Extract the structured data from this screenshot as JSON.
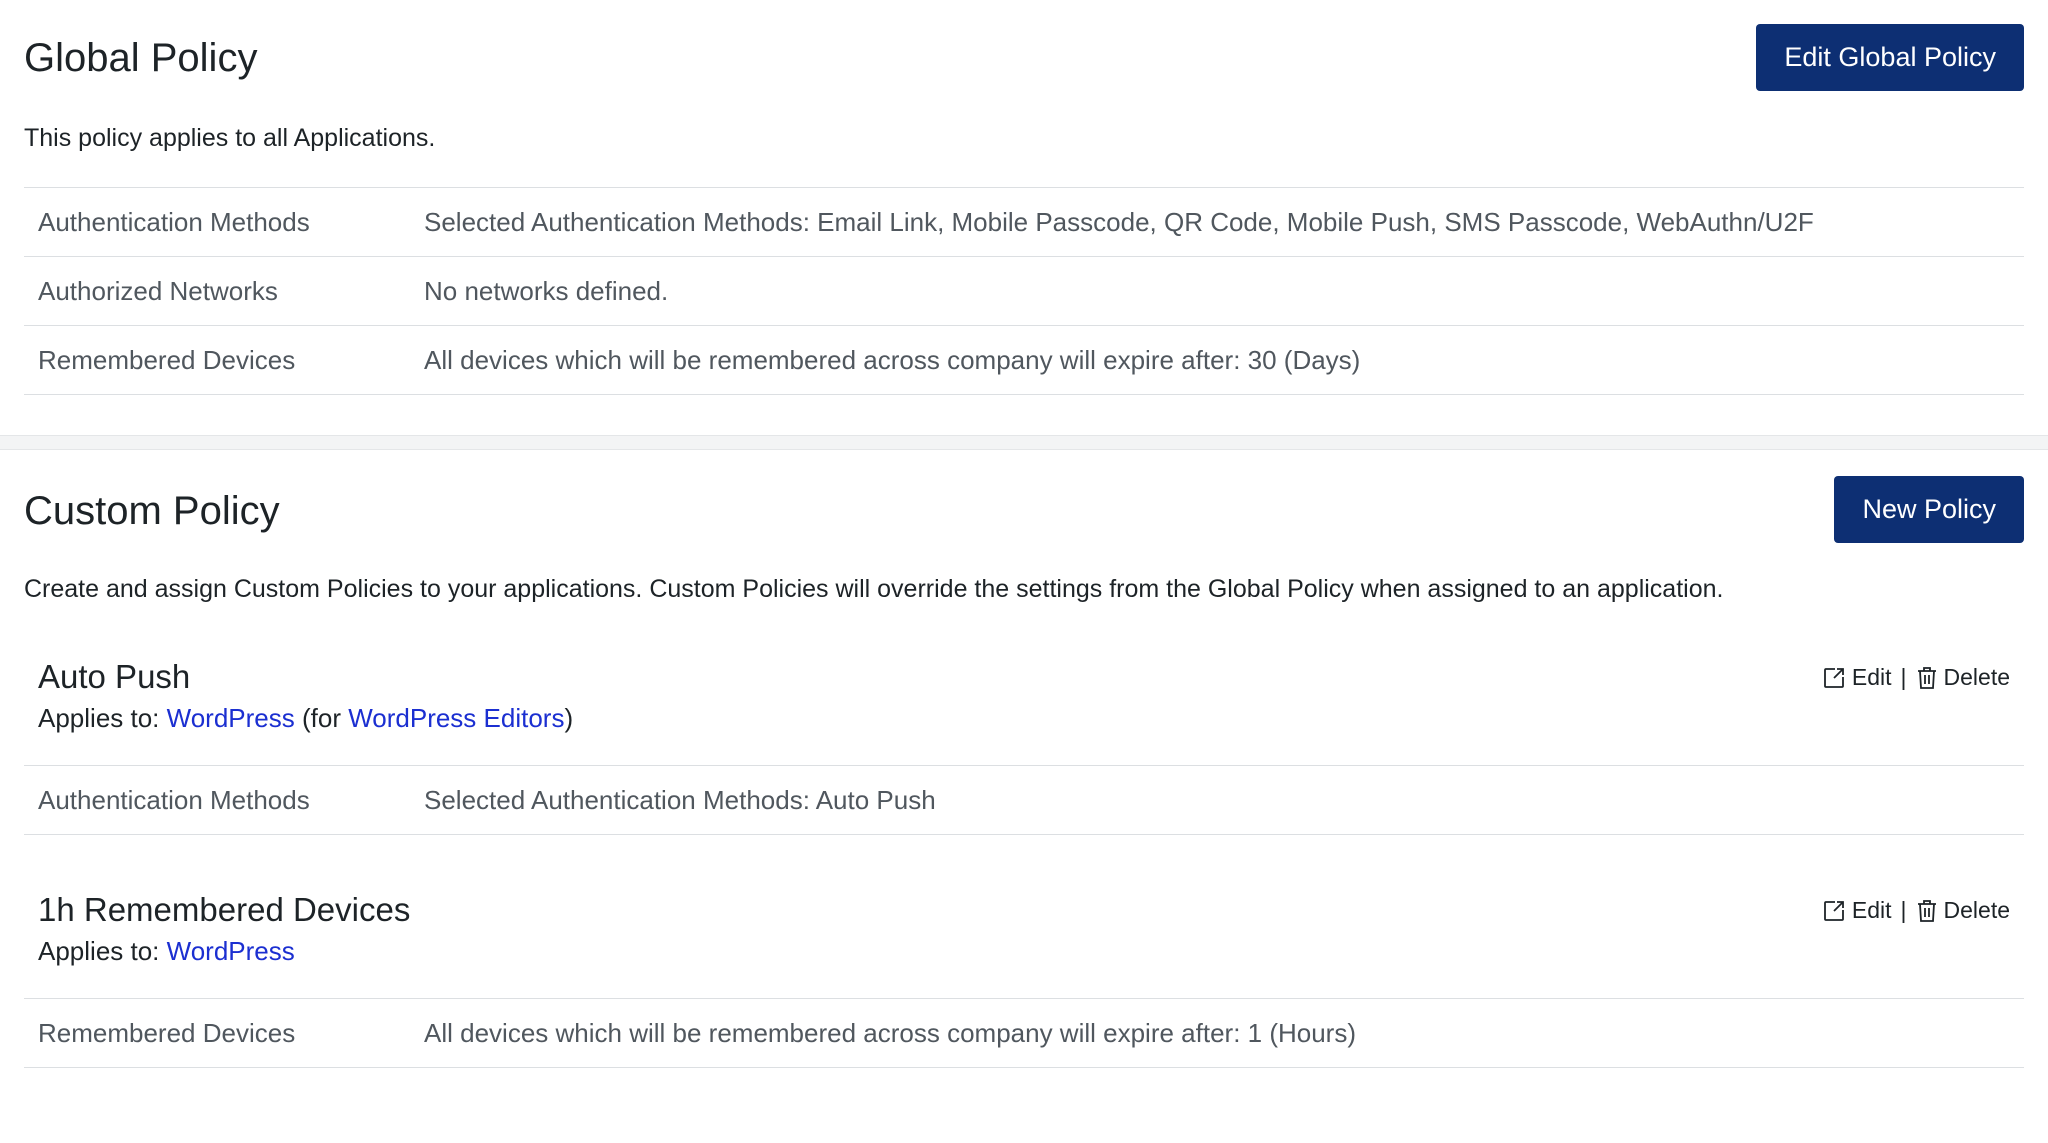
{
  "global": {
    "title": "Global Policy",
    "edit_button": "Edit Global Policy",
    "description": "This policy applies to all Applications.",
    "rows": [
      {
        "label": "Authentication Methods",
        "value": "Selected Authentication Methods: Email Link, Mobile Passcode, QR Code, Mobile Push, SMS Passcode, WebAuthn/U2F"
      },
      {
        "label": "Authorized Networks",
        "value": "No networks defined."
      },
      {
        "label": "Remembered Devices",
        "value": "All devices which will be remembered across company will expire after: 30 (Days)"
      }
    ]
  },
  "custom": {
    "title": "Custom Policy",
    "new_button": "New Policy",
    "description": "Create and assign Custom Policies to your applications. Custom Policies will override the settings from the Global Policy when assigned to an application.",
    "policies": [
      {
        "name": "Auto Push",
        "applies_prefix": "Applies to: ",
        "app_link": "WordPress",
        "for_open": " (for ",
        "role_link": "WordPress Editors",
        "for_close": ")",
        "edit_label": "Edit",
        "separator": "|",
        "delete_label": "Delete",
        "rows": [
          {
            "label": "Authentication Methods",
            "value": "Selected Authentication Methods: Auto Push"
          }
        ]
      },
      {
        "name": "1h Remembered Devices",
        "applies_prefix": "Applies to: ",
        "app_link": "WordPress",
        "edit_label": "Edit",
        "separator": "|",
        "delete_label": "Delete",
        "rows": [
          {
            "label": "Remembered Devices",
            "value": "All devices which will be remembered across company will expire after: 1 (Hours)"
          }
        ]
      }
    ]
  },
  "colors": {
    "primary_button": "#0d2f73",
    "link": "#1b2fd1",
    "muted_text": "#50575e"
  },
  "icons": [
    "edit-icon",
    "trash-icon"
  ]
}
